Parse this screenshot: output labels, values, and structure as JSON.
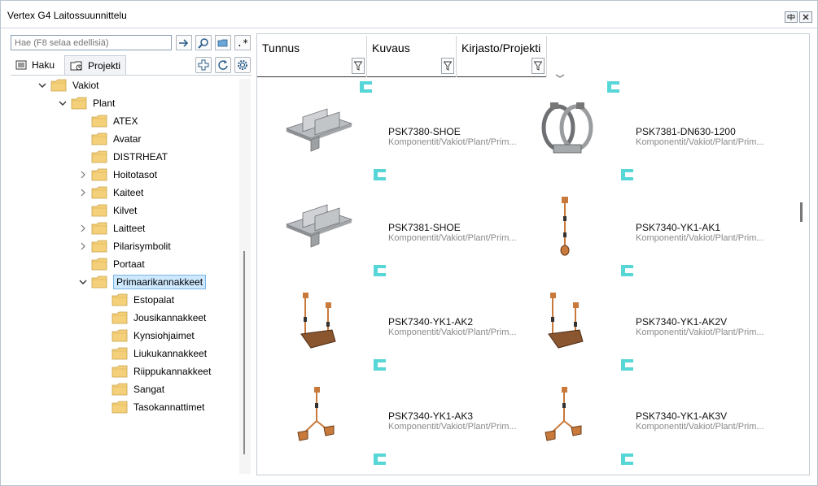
{
  "window": {
    "title": "Vertex G4 Laitossuunnittelu"
  },
  "search": {
    "placeholder": "Hae (F8 selaa edellisiä)"
  },
  "tabs": [
    {
      "label": "Haku"
    },
    {
      "label": "Projekti"
    }
  ],
  "tree": {
    "nodes": [
      {
        "label": "Vakiot",
        "expanded": true
      },
      {
        "label": "Plant",
        "expanded": true
      },
      {
        "label": "ATEX"
      },
      {
        "label": "Avatar"
      },
      {
        "label": "DISTRHEAT"
      },
      {
        "label": "Hoitotasot",
        "collapsed": true
      },
      {
        "label": "Kaiteet",
        "collapsed": true
      },
      {
        "label": "Kilvet"
      },
      {
        "label": "Laitteet",
        "collapsed": true
      },
      {
        "label": "Pilarisymbolit",
        "collapsed": true
      },
      {
        "label": "Portaat"
      },
      {
        "label": "Primaarikannakkeet",
        "expanded": true,
        "selected": true
      },
      {
        "label": "Estopalat"
      },
      {
        "label": "Jousikannakkeet"
      },
      {
        "label": "Kynsiohjaimet"
      },
      {
        "label": "Liukukannakkeet"
      },
      {
        "label": "Riippukannakkeet"
      },
      {
        "label": "Sangat"
      },
      {
        "label": "Tasokannattimet"
      }
    ]
  },
  "columns": [
    {
      "label": "Tunnus"
    },
    {
      "label": "Kuvaus"
    },
    {
      "label": "Kirjasto/Projekti"
    }
  ],
  "items": [
    {
      "code": "PSK7380-SHOE",
      "path": "Komponentit/Vakiot/Plant/Prim...",
      "icon": "shoe-support"
    },
    {
      "code": "PSK7381-DN630-1200",
      "path": "Komponentit/Vakiot/Plant/Prim...",
      "icon": "pipe-clamp"
    },
    {
      "code": "PSK7381-SHOE",
      "path": "Komponentit/Vakiot/Plant/Prim...",
      "icon": "shoe-support"
    },
    {
      "code": "PSK7340-YK1-AK1",
      "path": "Komponentit/Vakiot/Plant/Prim...",
      "icon": "hanger-rod"
    },
    {
      "code": "PSK7340-YK1-AK2",
      "path": "Komponentit/Vakiot/Plant/Prim...",
      "icon": "double-hanger"
    },
    {
      "code": "PSK7340-YK1-AK2V",
      "path": "Komponentit/Vakiot/Plant/Prim...",
      "icon": "double-hanger"
    },
    {
      "code": "PSK7340-YK1-AK3",
      "path": "Komponentit/Vakiot/Plant/Prim...",
      "icon": "triple-hanger"
    },
    {
      "code": "PSK7340-YK1-AK3V",
      "path": "Komponentit/Vakiot/Plant/Prim...",
      "icon": "triple-hanger"
    }
  ],
  "colors": {
    "accent": "#56d6d6",
    "selection": "#cde8ff",
    "folder": "#f4d07a",
    "copper": "#c87a3c"
  }
}
